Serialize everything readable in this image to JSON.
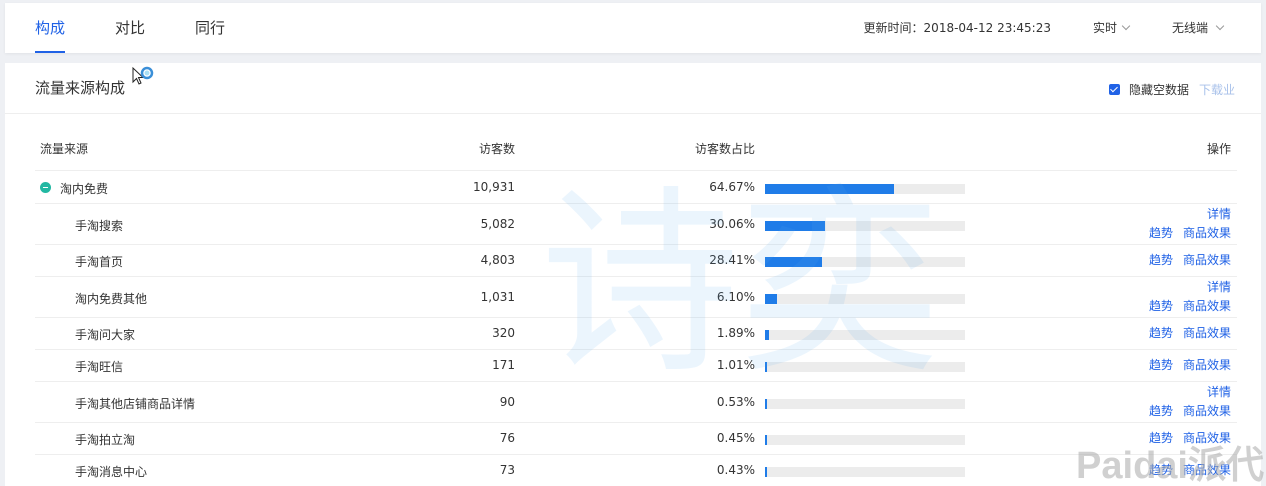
{
  "tabs": [
    {
      "label": "构成",
      "active": true
    },
    {
      "label": "对比",
      "active": false
    },
    {
      "label": "同行",
      "active": false
    }
  ],
  "header": {
    "update_time": "更新时间：2018-04-12 23:45:23",
    "realtime": "实时",
    "device": "无线端"
  },
  "panel": {
    "title": "流量来源构成",
    "hide_empty": "隐藏空数据",
    "download": "下载业"
  },
  "table": {
    "columns": [
      "流量来源",
      "访客数",
      "访客数占比",
      "操作"
    ],
    "rows": [
      {
        "name": "淘内免费",
        "visitors": "10,931",
        "pct": "64.67%",
        "fraction": 0.6467,
        "parent": true,
        "ops": []
      },
      {
        "name": "手淘搜索",
        "visitors": "5,082",
        "pct": "30.06%",
        "fraction": 0.3006,
        "parent": false,
        "ops": [
          [
            "详情"
          ],
          [
            "趋势",
            "商品效果"
          ]
        ]
      },
      {
        "name": "手淘首页",
        "visitors": "4,803",
        "pct": "28.41%",
        "fraction": 0.2841,
        "parent": false,
        "ops": [
          [
            "趋势",
            "商品效果"
          ]
        ]
      },
      {
        "name": "淘内免费其他",
        "visitors": "1,031",
        "pct": "6.10%",
        "fraction": 0.061,
        "parent": false,
        "ops": [
          [
            "详情"
          ],
          [
            "趋势",
            "商品效果"
          ]
        ]
      },
      {
        "name": "手淘问大家",
        "visitors": "320",
        "pct": "1.89%",
        "fraction": 0.0189,
        "parent": false,
        "ops": [
          [
            "趋势",
            "商品效果"
          ]
        ]
      },
      {
        "name": "手淘旺信",
        "visitors": "171",
        "pct": "1.01%",
        "fraction": 0.0101,
        "parent": false,
        "ops": [
          [
            "趋势",
            "商品效果"
          ]
        ]
      },
      {
        "name": "手淘其他店铺商品详情",
        "visitors": "90",
        "pct": "0.53%",
        "fraction": 0.0053,
        "parent": false,
        "ops": [
          [
            "详情"
          ],
          [
            "趋势",
            "商品效果"
          ]
        ]
      },
      {
        "name": "手淘拍立淘",
        "visitors": "76",
        "pct": "0.45%",
        "fraction": 0.0045,
        "parent": false,
        "ops": [
          [
            "趋势",
            "商品效果"
          ]
        ]
      },
      {
        "name": "手淘消息中心",
        "visitors": "73",
        "pct": "0.43%",
        "fraction": 0.0043,
        "parent": false,
        "ops": [
          [
            "趋势",
            "商品效果"
          ]
        ]
      }
    ]
  },
  "watermarks": {
    "center": "诗奕",
    "corner": "Paidai派代"
  },
  "colors": {
    "accent": "#2062e6",
    "bar": "#1f7ce8",
    "bar_bg": "#ececec",
    "parent_icon": "#22b8a2"
  }
}
